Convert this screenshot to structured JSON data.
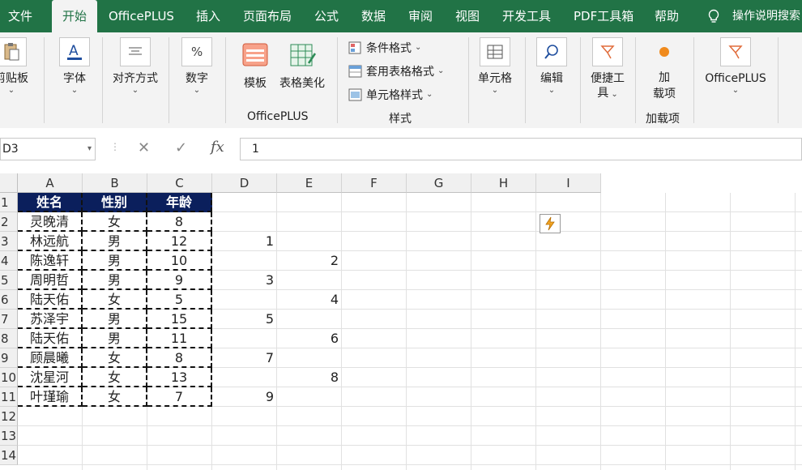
{
  "ribbon_tabs": [
    "文件",
    "开始",
    "OfficePLUS",
    "插入",
    "页面布局",
    "公式",
    "数据",
    "审阅",
    "视图",
    "开发工具",
    "PDF工具箱",
    "帮助"
  ],
  "tell_me": "操作说明搜索",
  "ribbon": {
    "clipboard": "剪贴板",
    "font": "字体",
    "align": "对齐方式",
    "number": "数字",
    "template": "模板",
    "beautify": "表格美化",
    "officeplus_group": "OfficePLUS",
    "cond_format": "条件格式",
    "table_format": "套用表格格式",
    "cell_style": "单元格样式",
    "styles_group": "样式",
    "cells": "单元格",
    "edit": "编辑",
    "quick_tools_1": "便捷工",
    "quick_tools_2": "具",
    "addin_1": "加",
    "addin_2": "载项",
    "addin_group": "加载项",
    "officeplus_btn": "OfficePLUS"
  },
  "formula_bar": {
    "name_box": "D3",
    "value": "1",
    "fx": "fx"
  },
  "columns": [
    "A",
    "B",
    "C",
    "D",
    "E",
    "F",
    "G",
    "H",
    "I"
  ],
  "rows": [
    "1",
    "2",
    "3",
    "4",
    "5",
    "6",
    "7",
    "8",
    "9",
    "10",
    "11",
    "12",
    "13",
    "14"
  ],
  "table": {
    "headers": [
      "姓名",
      "性别",
      "年龄"
    ],
    "rows": [
      [
        "灵晚清",
        "女",
        "8"
      ],
      [
        "林远航",
        "男",
        "12"
      ],
      [
        "陈逸轩",
        "男",
        "10"
      ],
      [
        "周明哲",
        "男",
        "9"
      ],
      [
        "陆天佑",
        "女",
        "5"
      ],
      [
        "苏泽宇",
        "男",
        "15"
      ],
      [
        "陆天佑",
        "男",
        "11"
      ],
      [
        "顾晨曦",
        "女",
        "8"
      ],
      [
        "沈星河",
        "女",
        "13"
      ],
      [
        "叶瑾瑜",
        "女",
        "7"
      ]
    ]
  },
  "d_values": [
    "",
    "1",
    "",
    "3",
    "",
    "5",
    "",
    "7",
    "",
    "9"
  ],
  "e_values": [
    "",
    "",
    "2",
    "",
    "4",
    "",
    "6",
    "",
    "8",
    ""
  ],
  "colors": {
    "accent": "#217346",
    "header_fill": "#0b1f5c"
  },
  "icons": {
    "flash_fill": "lightning-icon"
  }
}
